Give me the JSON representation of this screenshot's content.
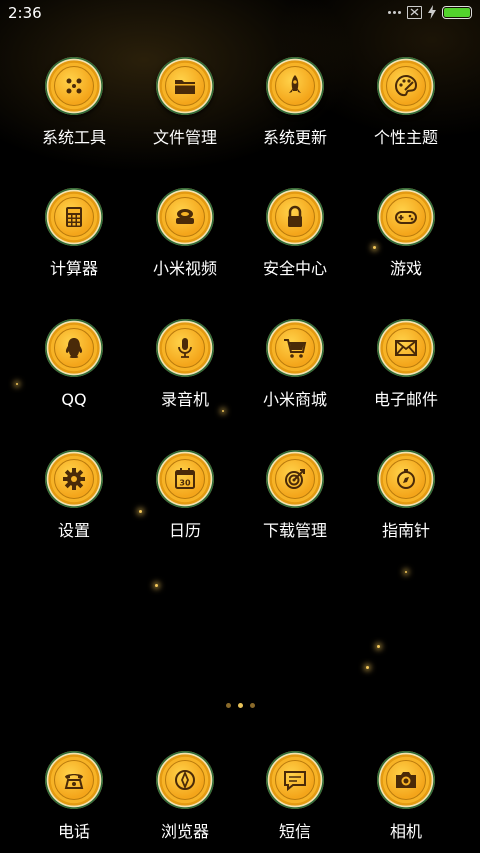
{
  "status_bar": {
    "time": "2:36"
  },
  "grid_apps": [
    {
      "label": "系统工具",
      "icon": "tools-icon"
    },
    {
      "label": "文件管理",
      "icon": "folder-icon"
    },
    {
      "label": "系统更新",
      "icon": "rocket-icon"
    },
    {
      "label": "个性主题",
      "icon": "palette-icon"
    },
    {
      "label": "计算器",
      "icon": "calculator-icon"
    },
    {
      "label": "小米视频",
      "icon": "video-icon"
    },
    {
      "label": "安全中心",
      "icon": "lock-icon"
    },
    {
      "label": "游戏",
      "icon": "gamepad-icon"
    },
    {
      "label": "QQ",
      "icon": "qq-penguin-icon"
    },
    {
      "label": "录音机",
      "icon": "microphone-icon"
    },
    {
      "label": "小米商城",
      "icon": "cart-icon"
    },
    {
      "label": "电子邮件",
      "icon": "mail-icon"
    },
    {
      "label": "设置",
      "icon": "gear-icon"
    },
    {
      "label": "日历",
      "icon": "calendar-icon",
      "calendar_day": "30"
    },
    {
      "label": "下载管理",
      "icon": "target-icon"
    },
    {
      "label": "指南针",
      "icon": "compass-icon"
    }
  ],
  "dock_apps": [
    {
      "label": "电话",
      "icon": "phone-icon"
    },
    {
      "label": "浏览器",
      "icon": "browser-icon"
    },
    {
      "label": "短信",
      "icon": "message-icon"
    },
    {
      "label": "相机",
      "icon": "camera-icon"
    }
  ],
  "page_indicator": {
    "count": 3,
    "active_index": 1
  },
  "colors": {
    "background": "#000000",
    "cap_gold": "#f7b326",
    "icon_glyph": "#4a2a08",
    "battery_green": "#52d22c"
  }
}
